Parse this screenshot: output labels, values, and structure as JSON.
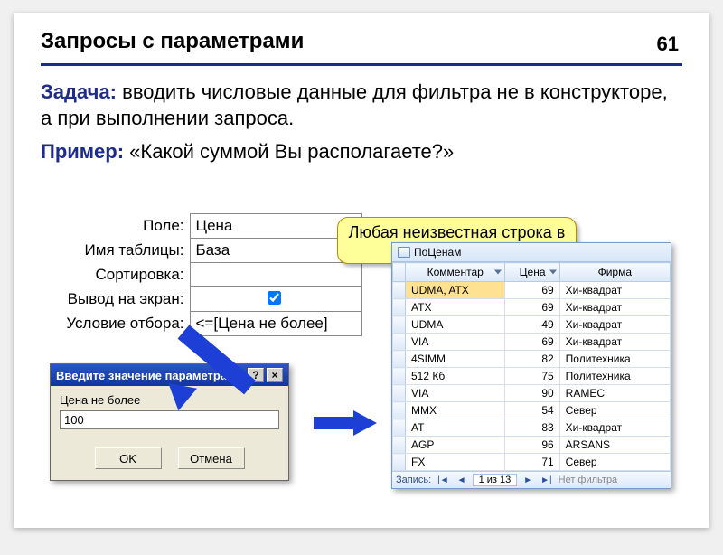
{
  "page_number": "61",
  "title": "Запросы с параметрами",
  "task_label": "Задача:",
  "task_text": " вводить числовые данные для фильтра не в конструкторе, а при выполнении запроса.",
  "example_label": "Пример:",
  "example_text": " «Какой суммой Вы располагаете?»",
  "callout": "Любая неизвестная строка в запросе",
  "designer": {
    "rows": {
      "field_label": "Поле:",
      "field_value": "Цена",
      "table_label": "Имя таблицы:",
      "table_value": "База",
      "sort_label": "Сортировка:",
      "show_label": "Вывод на экран:",
      "criteria_label": "Условие отбора:",
      "criteria_value": "<=[Цена не более]"
    }
  },
  "dialog": {
    "title": "Введите значение параметра",
    "help_icon": "?",
    "close_icon": "×",
    "prompt": "Цена не более",
    "value": "100",
    "ok": "OK",
    "cancel": "Отмена"
  },
  "datasheet": {
    "tab": "ПоЦенам",
    "columns": {
      "c1": "Комментар",
      "c2": "Цена",
      "c3": "Фирма"
    },
    "rows": [
      {
        "c1": "UDMA, ATX",
        "c2": "69",
        "c3": "Хи-квадрат"
      },
      {
        "c1": "ATX",
        "c2": "69",
        "c3": "Хи-квадрат"
      },
      {
        "c1": "UDMA",
        "c2": "49",
        "c3": "Хи-квадрат"
      },
      {
        "c1": "VIA",
        "c2": "69",
        "c3": "Хи-квадрат"
      },
      {
        "c1": "4SIMM",
        "c2": "82",
        "c3": "Политехника"
      },
      {
        "c1": "512 Кб",
        "c2": "75",
        "c3": "Политехника"
      },
      {
        "c1": "VIA",
        "c2": "90",
        "c3": "RAMEC"
      },
      {
        "c1": "MMX",
        "c2": "54",
        "c3": "Север"
      },
      {
        "c1": "AT",
        "c2": "83",
        "c3": "Хи-квадрат"
      },
      {
        "c1": "AGP",
        "c2": "96",
        "c3": "ARSANS"
      },
      {
        "c1": "FX",
        "c2": "71",
        "c3": "Север"
      }
    ],
    "nav_label": "Запись:",
    "nav_pos": "1 из 13",
    "nav_filter": "Нет фильтра"
  }
}
